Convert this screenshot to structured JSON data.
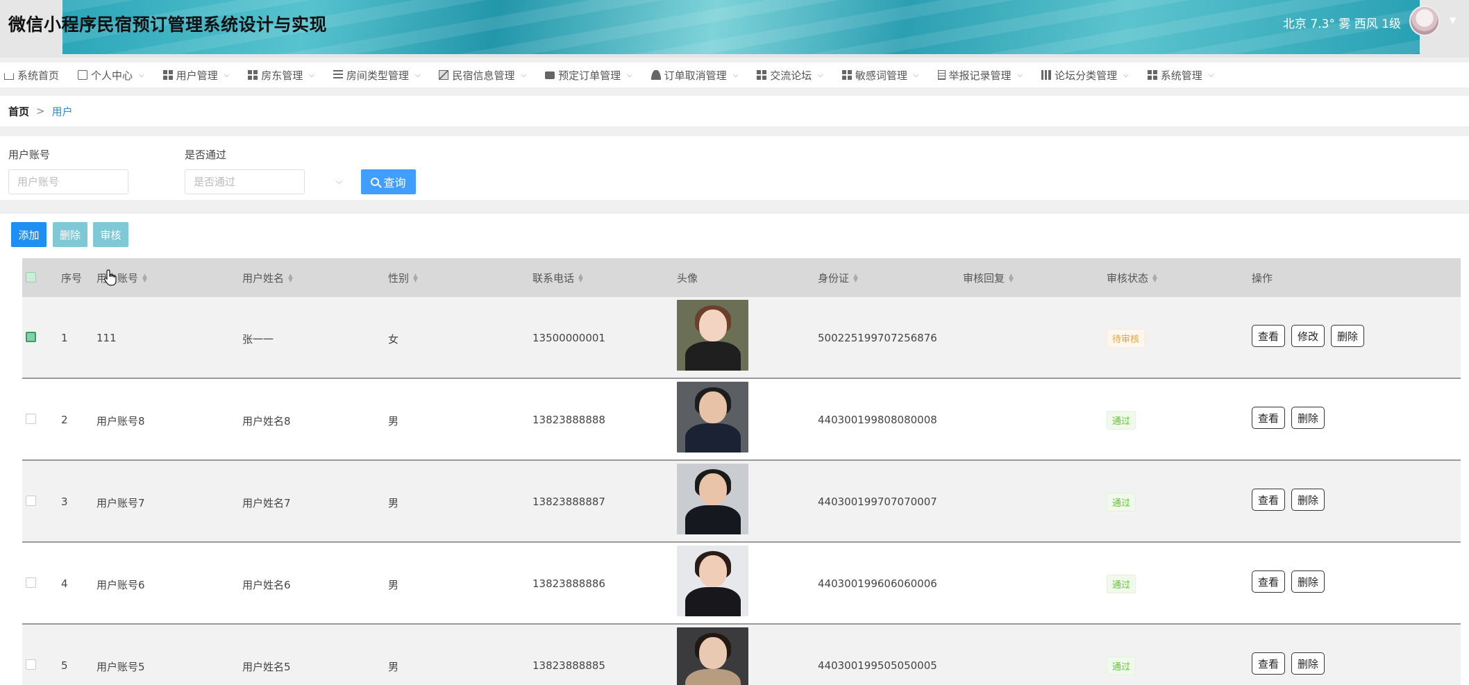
{
  "app_title": "微信小程序民宿预订管理系统设计与实现",
  "weather": "北京 7.3° 雾 西风 1级",
  "nav": [
    {
      "label": "系统首页",
      "icon": "home-icon",
      "caret": false
    },
    {
      "label": "个人中心",
      "icon": "profile-card-icon",
      "caret": true
    },
    {
      "label": "用户管理",
      "icon": "grid-icon",
      "caret": true
    },
    {
      "label": "房东管理",
      "icon": "grid-icon",
      "caret": true
    },
    {
      "label": "房间类型管理",
      "icon": "list-icon",
      "caret": true
    },
    {
      "label": "民宿信息管理",
      "icon": "chart-icon",
      "caret": true
    },
    {
      "label": "预定订单管理",
      "icon": "monitor-icon",
      "caret": true
    },
    {
      "label": "订单取消管理",
      "icon": "user-icon",
      "caret": true
    },
    {
      "label": "交流论坛",
      "icon": "grid-icon",
      "caret": true
    },
    {
      "label": "敏感词管理",
      "icon": "grid-icon",
      "caret": true
    },
    {
      "label": "举报记录管理",
      "icon": "document-icon",
      "caret": true
    },
    {
      "label": "论坛分类管理",
      "icon": "bar-chart-icon",
      "caret": true
    },
    {
      "label": "系统管理",
      "icon": "grid-icon",
      "caret": true
    }
  ],
  "breadcrumb": {
    "home": "首页",
    "separator": ">",
    "current": "用户"
  },
  "search": {
    "account_label": "用户账号",
    "account_placeholder": "用户账号",
    "approved_label": "是否通过",
    "approved_placeholder": "是否通过",
    "query_label": "查询"
  },
  "actions": {
    "add": "添加",
    "delete": "删除",
    "audit": "审核"
  },
  "table": {
    "headers": {
      "index": "序号",
      "account": "用户账号",
      "name": "用户姓名",
      "gender": "性别",
      "phone": "联系电话",
      "avatar": "头像",
      "id_card": "身份证",
      "audit_reply": "审核回复",
      "audit_status": "审核状态",
      "operation": "操作"
    },
    "rows": [
      {
        "index": "1",
        "account": "111",
        "name": "张一一",
        "gender": "女",
        "phone": "13500000001",
        "id_card": "500225199707256876",
        "audit_reply": "",
        "status": "待审核",
        "status_type": "pending",
        "checked": true,
        "ops": [
          "查看",
          "修改",
          "删除"
        ],
        "photo": {
          "bg": "#6a6f55",
          "skin": "#f3d3c2",
          "hair": "#6b3f2a",
          "clothes": "#1f1f1f"
        }
      },
      {
        "index": "2",
        "account": "用户账号8",
        "name": "用户姓名8",
        "gender": "男",
        "phone": "13823888888",
        "id_card": "440300199808080008",
        "audit_reply": "",
        "status": "通过",
        "status_type": "pass",
        "checked": false,
        "ops": [
          "查看",
          "删除"
        ],
        "photo": {
          "bg": "#5b5f64",
          "skin": "#e8c2a6",
          "hair": "#1d1d1d",
          "clothes": "#1b2233"
        }
      },
      {
        "index": "3",
        "account": "用户账号7",
        "name": "用户姓名7",
        "gender": "男",
        "phone": "13823888887",
        "id_card": "440300199707070007",
        "audit_reply": "",
        "status": "通过",
        "status_type": "pass",
        "checked": false,
        "ops": [
          "查看",
          "删除"
        ],
        "photo": {
          "bg": "#c9cdd2",
          "skin": "#e9c4a8",
          "hair": "#1a1a1a",
          "clothes": "#15181f"
        }
      },
      {
        "index": "4",
        "account": "用户账号6",
        "name": "用户姓名6",
        "gender": "男",
        "phone": "13823888886",
        "id_card": "440300199606060006",
        "audit_reply": "",
        "status": "通过",
        "status_type": "pass",
        "checked": false,
        "ops": [
          "查看",
          "删除"
        ],
        "photo": {
          "bg": "#e6e8ec",
          "skin": "#f0cdb6",
          "hair": "#2a1d17",
          "clothes": "#17171c"
        }
      },
      {
        "index": "5",
        "account": "用户账号5",
        "name": "用户姓名5",
        "gender": "男",
        "phone": "13823888885",
        "id_card": "440300199505050005",
        "audit_reply": "",
        "status": "通过",
        "status_type": "pass",
        "checked": false,
        "ops": [
          "查看",
          "删除"
        ],
        "photo": {
          "bg": "#3b3a3d",
          "skin": "#eac9b2",
          "hair": "#211814",
          "clothes": "#b89c80"
        }
      }
    ]
  },
  "colors": {
    "primary": "#409eff",
    "add_button": "#1e8ff5",
    "muted_button": "#7fc9d6",
    "breadcrumb_active": "#2a8dd4"
  }
}
